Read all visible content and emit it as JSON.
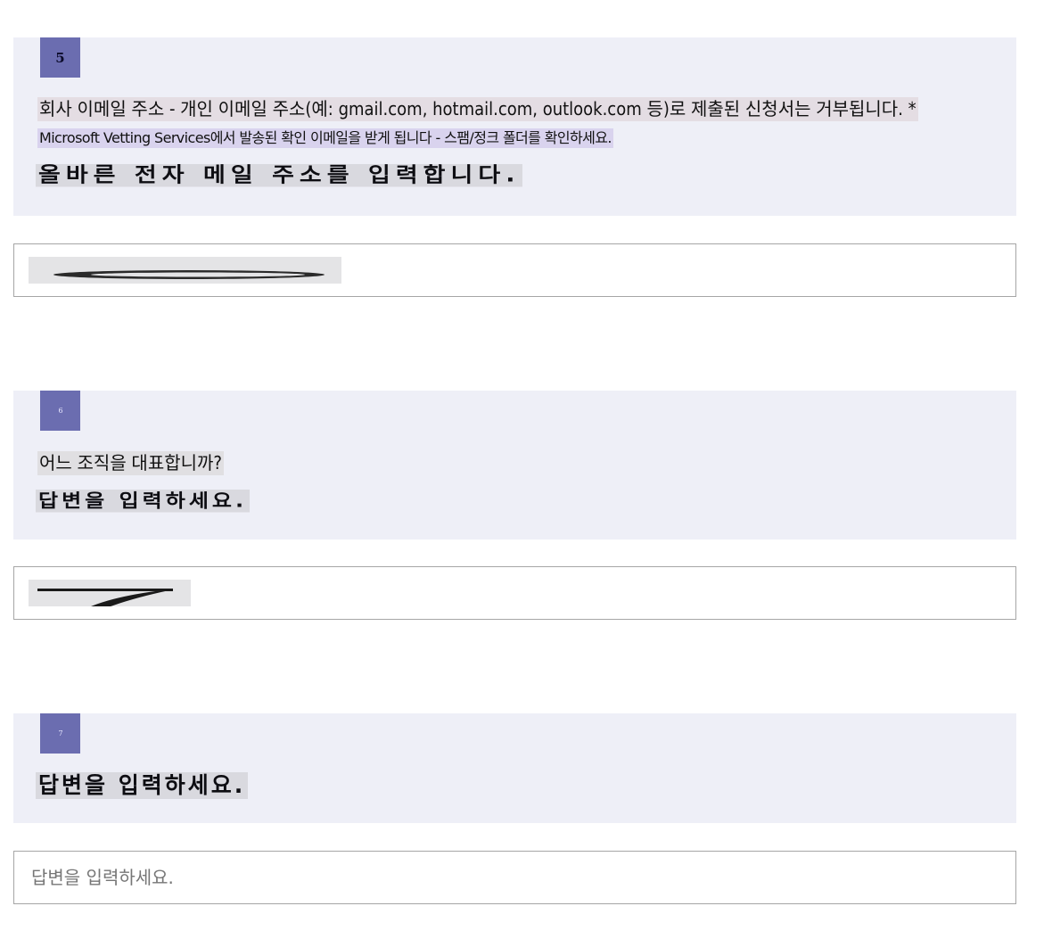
{
  "questions": [
    {
      "number": "5",
      "text": "회사 이메일 주소 - 개인 이메일 주소(예: gmail.com, hotmail.com, outlook.com 등)로 제출된 신청서는 거부됩니다. *",
      "subtext": "Microsoft Vetting Services에서 발송된 확인 이메일을 받게 됩니다 - 스팸/정크 폴더를 확인하세요.",
      "hint": "올바른 전자 메일 주소를 입력합니다."
    },
    {
      "number": "6",
      "text": "어느 조직을 대표합니까?",
      "hint": "답변을 입력하세요."
    },
    {
      "number": "7",
      "hint": "답변을 입력하세요.",
      "placeholder": "답변을 입력하세요."
    }
  ],
  "colors": {
    "block_bg": "#eeeff7",
    "badge_bg": "#6b6db0",
    "input_border": "#a6a6a6"
  }
}
